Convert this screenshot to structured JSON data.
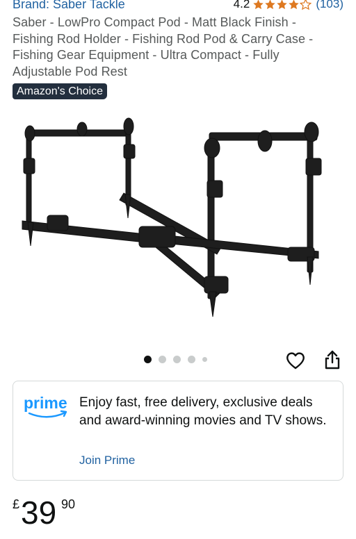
{
  "product": {
    "brand": "Brand: Saber Tackle",
    "rating": "4.2",
    "rating_stars": 4.2,
    "review_count": "(103)",
    "title": "Saber - LowPro Compact Pod - Matt Black Finish - Fishing Rod Holder - Fishing Rod Pod & Carry Case - Fishing Gear Equipment - Ultra Compact - Fully Adjustable Pod Rest",
    "badge": "Amazon's Choice"
  },
  "gallery": {
    "image_count": 5,
    "active_index": 0
  },
  "prime": {
    "logo_text": "prime",
    "message": "Enjoy fast, free delivery, exclusive deals and award-winning movies and TV shows.",
    "cta": "Join Prime"
  },
  "price": {
    "symbol": "£",
    "whole": "39",
    "fraction": "90"
  },
  "colors": {
    "link": "#2162a1",
    "star": "#de7921",
    "badge_bg": "#232f3e",
    "prime_blue": "#1a98ff"
  },
  "icons": {
    "wishlist": "heart-outline-icon",
    "share": "share-icon"
  }
}
